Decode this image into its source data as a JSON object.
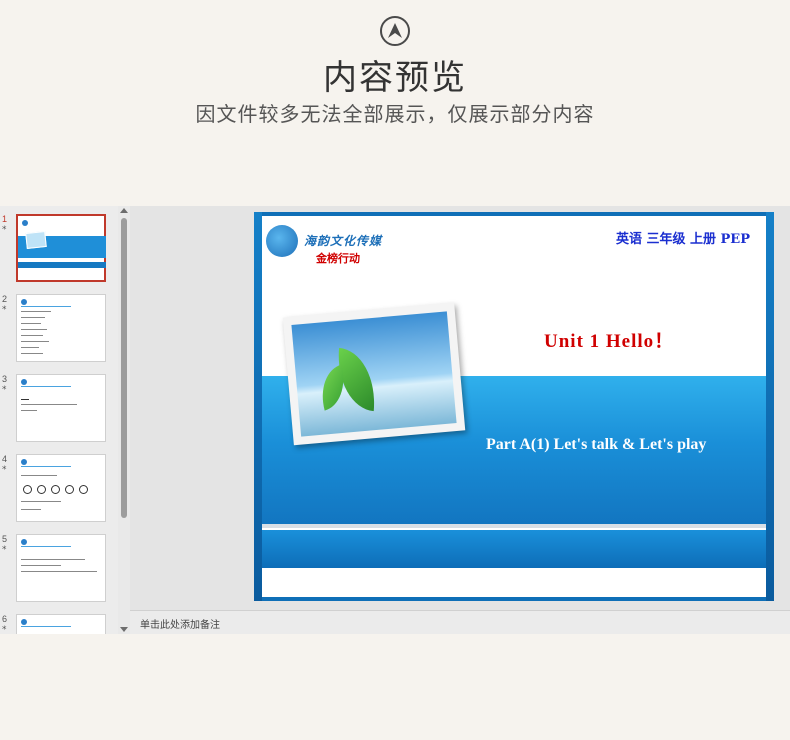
{
  "header": {
    "title": "内容预览",
    "subtitle": "因文件较多无法全部展示，仅展示部分内容"
  },
  "thumbnails": [
    {
      "number": "1",
      "mark": "*",
      "selected": true
    },
    {
      "number": "2",
      "mark": "*",
      "selected": false
    },
    {
      "number": "3",
      "mark": "*",
      "selected": false
    },
    {
      "number": "4",
      "mark": "*",
      "selected": false
    },
    {
      "number": "5",
      "mark": "*",
      "selected": false
    },
    {
      "number": "6",
      "mark": "*",
      "selected": false
    }
  ],
  "slide": {
    "logo_text": "海韵文化传媒",
    "brand": "金榜行动",
    "course": "英语  三年级  上册  PEP",
    "unit_title": "Unit 1    Hello！",
    "unit_sub": "Part A(1)    Let's talk & Let's play"
  },
  "notes": {
    "placeholder": "单击此处添加备注"
  },
  "colors": {
    "accent_red": "#d00000",
    "course_blue": "#1b2fd0",
    "band_blue": "#1a8fd8",
    "selection": "#c0392b"
  }
}
